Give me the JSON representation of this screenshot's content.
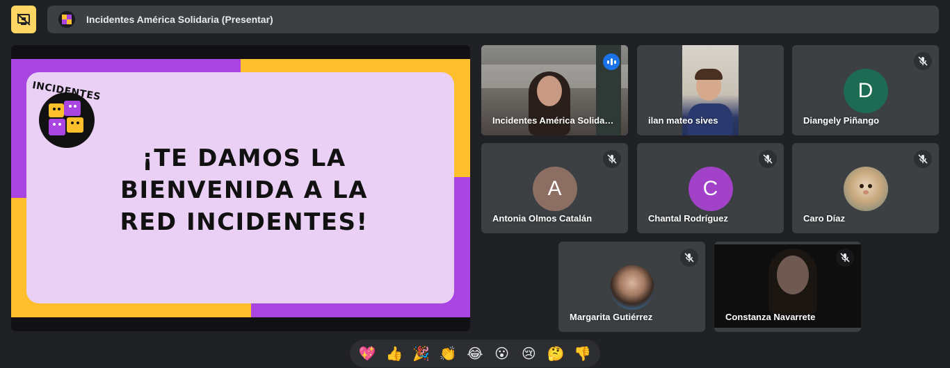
{
  "toolbar": {
    "present_icon": "screen-share-off-icon",
    "presenter_title": "Incidentes América Solidaria (Presentar)"
  },
  "slide": {
    "logo_text": "INCIDENTES",
    "headline": "¡Te damos la bienvenida a la Red Incidentes!",
    "colors": {
      "purple": "#a945e0",
      "yellow": "#fdc02c",
      "card": "#ead0f5"
    }
  },
  "participants": [
    {
      "name": "Incidentes América Solidaria",
      "speaking": true
    },
    {
      "name": "ilan mateo sives"
    },
    {
      "name": "Diangely Piñango",
      "initial": "D",
      "color": "#1e6b53",
      "muted": true
    },
    {
      "name": "Antonia Olmos Catalán",
      "initial": "A",
      "color": "#8d6e63",
      "muted": true
    },
    {
      "name": "Chantal Rodríguez",
      "initial": "C",
      "color": "#a142c8",
      "muted": true
    },
    {
      "name": "Caro Díaz",
      "muted": true
    },
    {
      "name": "Margarita Gutiérrez",
      "muted": true
    },
    {
      "name": "Constanza Navarrete",
      "muted": true
    }
  ],
  "reactions": [
    "💖",
    "👍",
    "🎉",
    "👏",
    "😂",
    "😮",
    "😢",
    "🤔",
    "👎"
  ]
}
